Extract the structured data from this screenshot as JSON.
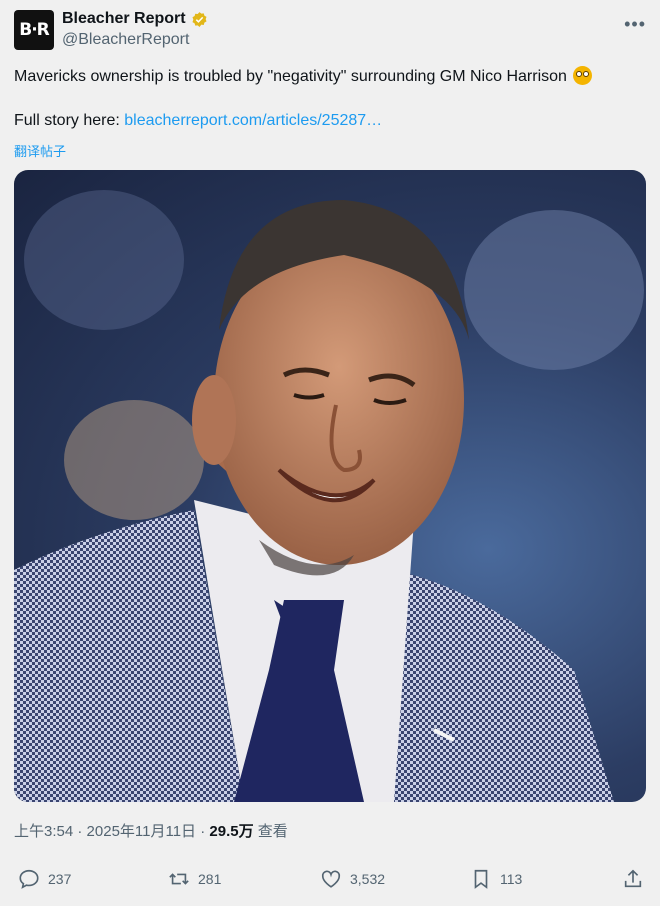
{
  "author": {
    "avatar_text": "B·R",
    "display_name": "Bleacher Report",
    "handle": "@BleacherReport"
  },
  "tweet": {
    "line1": "Mavericks ownership is troubled by \"negativity\" surrounding GM Nico Harrison",
    "line1_emoji": "flushed-face-emoji",
    "line2_prefix": "Full story here: ",
    "link_text": "bleacherreport.com/articles/25287…",
    "translate_label": "翻译帖子"
  },
  "meta": {
    "time": "上午3:54",
    "date": "2025年11月11日",
    "separator": "·",
    "views": "29.5万",
    "views_label": "查看"
  },
  "actions": {
    "replies": "237",
    "reposts": "281",
    "likes": "3,532",
    "bookmarks": "113"
  },
  "colors": {
    "link": "#1d9bf0",
    "secondary_text": "#536471",
    "verified_badge": "#e2b719"
  },
  "icons": [
    "verified-badge-icon",
    "more-options-icon",
    "reply-icon",
    "repost-icon",
    "like-icon",
    "bookmark-icon",
    "share-icon"
  ]
}
